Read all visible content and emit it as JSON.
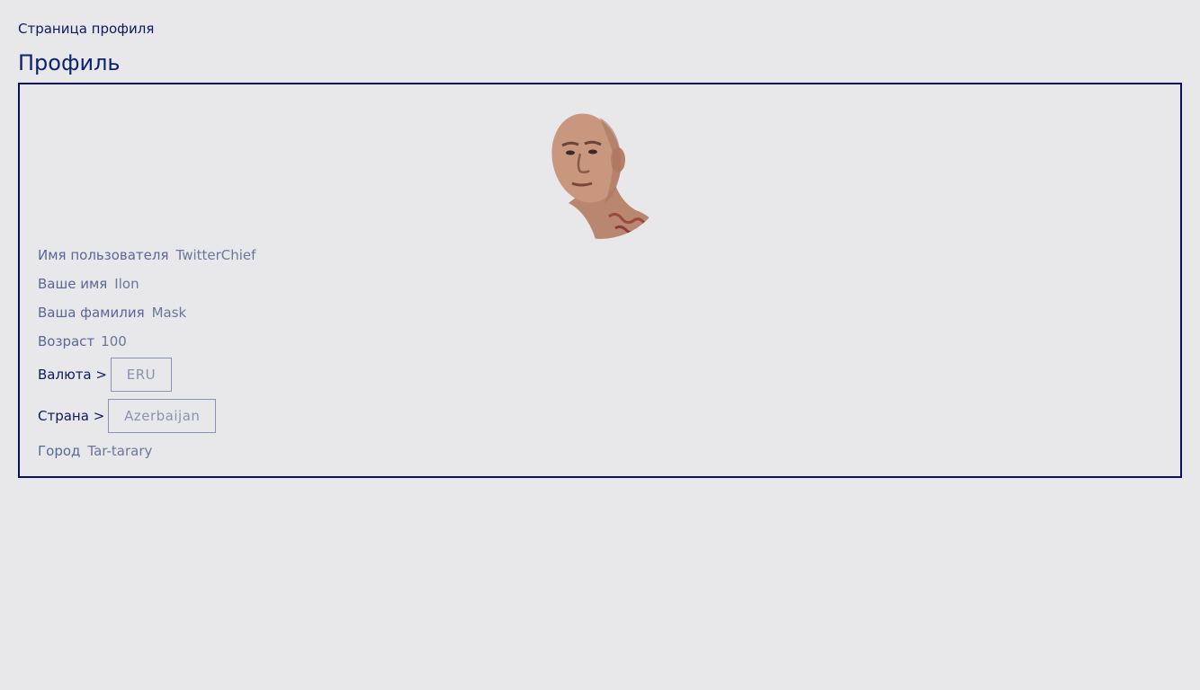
{
  "breadcrumb": "Страница профиля",
  "page_title": "Профиль",
  "profile": {
    "avatar_alt": "avatar",
    "username_label": "Имя пользователя",
    "username_value": "TwitterChief",
    "firstname_label": "Ваше имя",
    "firstname_value": "Ilon",
    "lastname_label": "Ваша фамилия",
    "lastname_value": "Mask",
    "age_label": "Возраст",
    "age_value": "100",
    "currency_label": "Валюта >",
    "currency_value": "ERU",
    "country_label": "Страна >",
    "country_value": "Azerbaijan",
    "city_label": "Город",
    "city_value": "Tar-tarary"
  },
  "colors": {
    "background": "#e8e8eb",
    "accent": "#0d1a5c",
    "border": "#0d1060",
    "muted_text": "#5a6796"
  }
}
